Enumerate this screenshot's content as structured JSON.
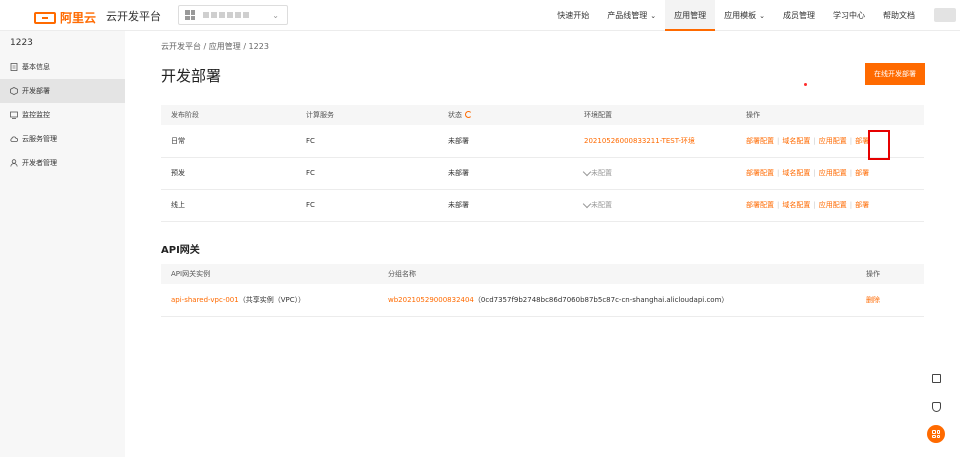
{
  "header": {
    "logo_text": "阿里云",
    "platform_title": "云开发平台",
    "nav": [
      {
        "label": "快速开始",
        "caret": false
      },
      {
        "label": "产品线管理",
        "caret": true
      },
      {
        "label": "应用管理",
        "caret": false,
        "active": true
      },
      {
        "label": "应用模板",
        "caret": true
      },
      {
        "label": "成员管理",
        "caret": false
      },
      {
        "label": "学习中心",
        "caret": false
      },
      {
        "label": "帮助文档",
        "caret": false
      }
    ],
    "accent": "#ff6a00"
  },
  "sidebar": {
    "title": "1223",
    "items": [
      {
        "label": "基本信息",
        "icon": "file-icon"
      },
      {
        "label": "开发部署",
        "icon": "cube-icon",
        "active": true
      },
      {
        "label": "监控监控",
        "icon": "monitor-icon"
      },
      {
        "label": "云服务管理",
        "icon": "cloud-icon"
      },
      {
        "label": "开发者管理",
        "icon": "user-icon"
      }
    ]
  },
  "main": {
    "breadcrumb": "云开发平台 / 应用管理 / 1223",
    "page_title": "开发部署",
    "primary_button": "在线开发部署",
    "deploy_table": {
      "headers": [
        "发布阶段",
        "计算服务",
        "状态",
        "环境配置",
        "操作"
      ],
      "rows": [
        {
          "stage": "日常",
          "compute": "FC",
          "status": "未部署",
          "env": "20210526000833211-TEST-环境",
          "env_set": true
        },
        {
          "stage": "预发",
          "compute": "FC",
          "status": "未部署",
          "env": "未配置",
          "env_set": false
        },
        {
          "stage": "线上",
          "compute": "FC",
          "status": "未部署",
          "env": "未配置",
          "env_set": false
        }
      ],
      "actions": [
        "部署配置",
        "域名配置",
        "应用配置",
        "部署"
      ]
    },
    "gateway": {
      "title": "API网关",
      "headers": [
        "API网关实例",
        "分组名称",
        "操作"
      ],
      "rows": [
        {
          "instance": "api-shared-vpc-001",
          "instance_note": "（共享实例（VPC））",
          "group": "wb20210529000832404",
          "group_note": "（0cd7357f9b2748bc86d7060b87b5c87c-cn-shanghai.alicloudapi.com）",
          "action": "删除"
        }
      ]
    }
  }
}
